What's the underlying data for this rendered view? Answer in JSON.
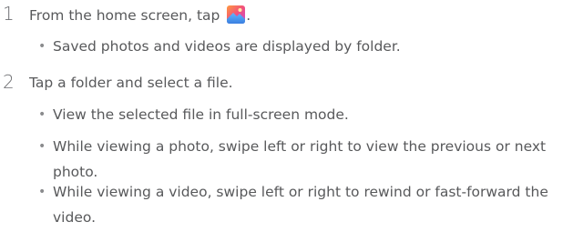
{
  "steps": [
    {
      "number": "1",
      "text_before_icon": "From the home screen, tap ",
      "text_after_icon": ".",
      "icon": "gallery-app-icon",
      "bullets": [
        "Saved photos and videos are displayed by folder."
      ]
    },
    {
      "number": "2",
      "text": "Tap a folder and select a file.",
      "bullets": [
        "View the selected file in full-screen mode.",
        "While viewing a photo, swipe left or right to view the previous or next photo.",
        "While viewing a video, swipe left or right to rewind or fast-forward the video."
      ]
    }
  ],
  "colors": {
    "text": "#58595b",
    "bullet": "#8a8b8d",
    "icon_orange": "#f26b3a",
    "icon_pink": "#ec4a8c",
    "icon_blue": "#4a90e2"
  }
}
